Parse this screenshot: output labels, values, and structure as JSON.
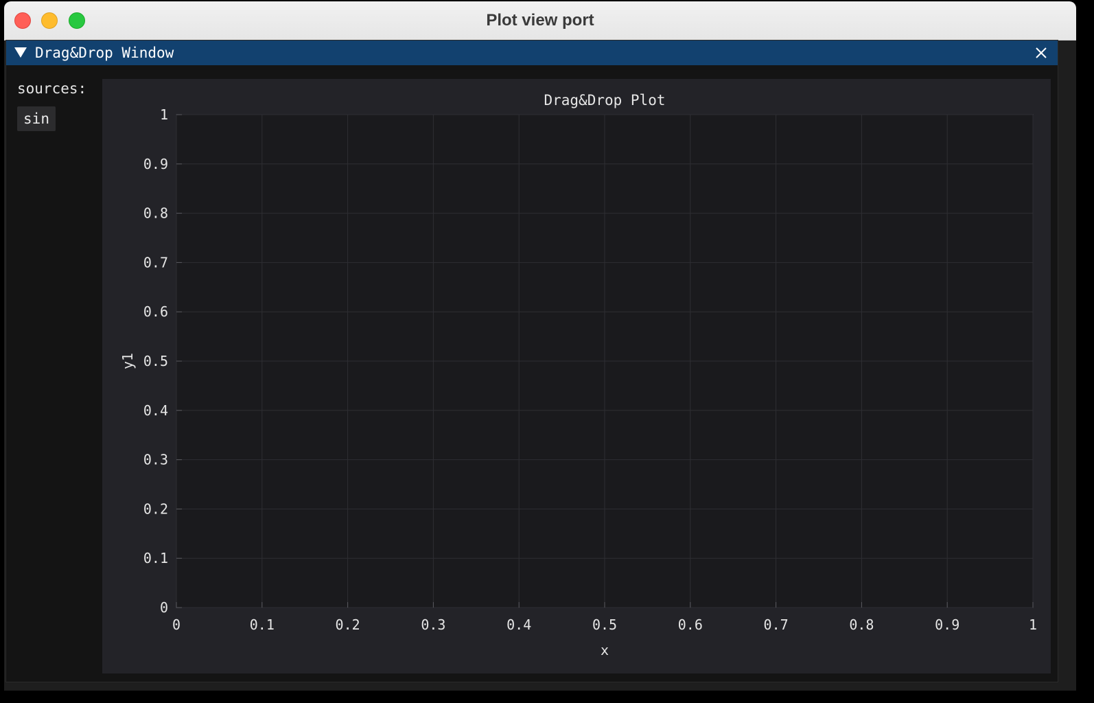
{
  "window": {
    "title": "Plot view port"
  },
  "imgui": {
    "title": "Drag&Drop Window",
    "sources_label": "sources:",
    "sources": [
      "sin"
    ]
  },
  "colors": {
    "titlebar": "#12416f",
    "plot_bg": "#1a1a1d",
    "frame_bg": "#232328",
    "grid": "#2e2e33",
    "axis": "#5a5a60",
    "text": "#e6e6e6"
  },
  "chart_data": {
    "type": "line",
    "title": "Drag&Drop Plot",
    "xlabel": "x",
    "ylabel": "y1",
    "xlim": [
      0,
      1
    ],
    "ylim": [
      0,
      1
    ],
    "x_ticks": [
      "0",
      "0.1",
      "0.2",
      "0.3",
      "0.4",
      "0.5",
      "0.6",
      "0.7",
      "0.8",
      "0.9",
      "1"
    ],
    "y_ticks": [
      "0",
      "0.1",
      "0.2",
      "0.3",
      "0.4",
      "0.5",
      "0.6",
      "0.7",
      "0.8",
      "0.9",
      "1"
    ],
    "grid": true,
    "series": []
  }
}
